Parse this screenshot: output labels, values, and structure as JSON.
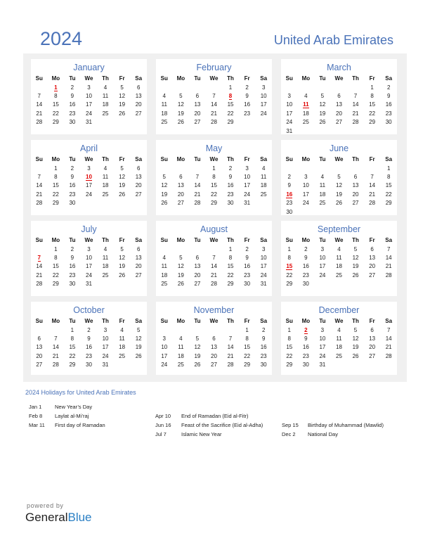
{
  "header": {
    "year": "2024",
    "country": "United Arab Emirates"
  },
  "weekdays": [
    "Su",
    "Mo",
    "Tu",
    "We",
    "Th",
    "Fr",
    "Sa"
  ],
  "months": [
    {
      "name": "January",
      "start": 1,
      "days": 31,
      "holidays": [
        1
      ]
    },
    {
      "name": "February",
      "start": 4,
      "days": 29,
      "holidays": [
        8
      ]
    },
    {
      "name": "March",
      "start": 5,
      "days": 31,
      "holidays": [
        11
      ]
    },
    {
      "name": "April",
      "start": 1,
      "days": 30,
      "holidays": [
        10
      ]
    },
    {
      "name": "May",
      "start": 3,
      "days": 31,
      "holidays": []
    },
    {
      "name": "June",
      "start": 6,
      "days": 30,
      "holidays": [
        16
      ]
    },
    {
      "name": "July",
      "start": 1,
      "days": 31,
      "holidays": [
        7
      ]
    },
    {
      "name": "August",
      "start": 4,
      "days": 31,
      "holidays": []
    },
    {
      "name": "September",
      "start": 0,
      "days": 30,
      "holidays": [
        15
      ]
    },
    {
      "name": "October",
      "start": 2,
      "days": 31,
      "holidays": []
    },
    {
      "name": "November",
      "start": 5,
      "days": 30,
      "holidays": []
    },
    {
      "name": "December",
      "start": 0,
      "days": 31,
      "holidays": [
        2
      ]
    }
  ],
  "holidays_section": {
    "title": "2024 Holidays for United Arab Emirates",
    "columns": [
      [
        {
          "date": "Jan 1",
          "name": "New Year’s Day"
        },
        {
          "date": "Feb 8",
          "name": "Laylat al-Mi’raj"
        },
        {
          "date": "Mar 11",
          "name": "First day of Ramadan"
        }
      ],
      [
        {
          "date": "Apr 10",
          "name": "End of Ramadan (Eid al-Fitr)"
        },
        {
          "date": "Jun 16",
          "name": "Feast of the Sacrifice (Eid al-Adha)"
        },
        {
          "date": "Jul 7",
          "name": "Islamic New Year"
        }
      ],
      [
        {
          "date": "Sep 15",
          "name": "Birthday of Muhammad (Mawlid)"
        },
        {
          "date": "Dec 2",
          "name": "National Day"
        }
      ]
    ]
  },
  "footer": {
    "powered_by": "powered by",
    "brand_part1": "General",
    "brand_part2": "Blue"
  },
  "colors": {
    "accent": "#4a72b8",
    "holiday": "#e00000",
    "background_panel": "#f0f0f0"
  }
}
